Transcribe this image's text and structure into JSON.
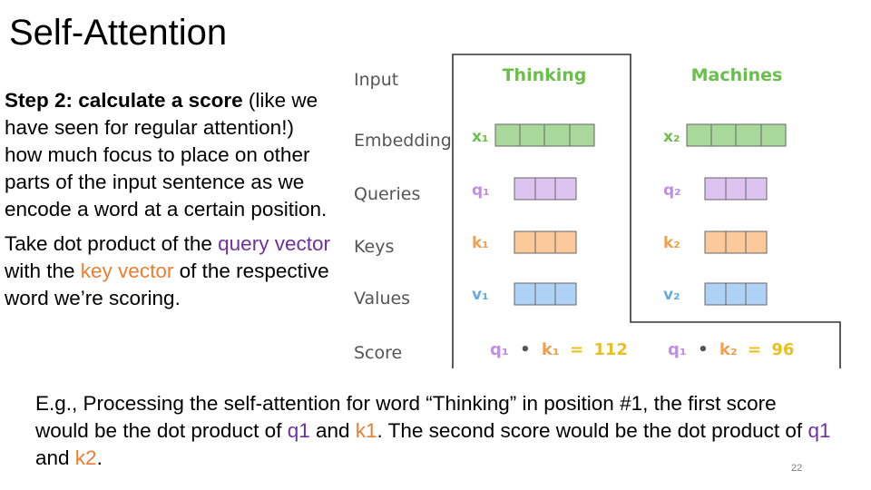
{
  "title": "Self-Attention",
  "left": {
    "p1": {
      "bold": "Step 2: calculate a score",
      "rest": " (like we have seen for regular attention!)  how much focus to place on other parts of the input sentence as we encode a word at a certain position."
    },
    "p2": {
      "a": "Take dot product of the ",
      "query": "query vector",
      "b": " with the ",
      "key": "key vector",
      "c": " of the respective word we’re scoring."
    }
  },
  "bottom": {
    "a": "E.g., Processing the self-attention for word “Thinking” in position #1, the first score would be the dot product of ",
    "q1": "q1",
    "b": " and ",
    "k1": "k1",
    "c": ". The second score would be the dot product of ",
    "q1b": "q1",
    "d": " and ",
    "k2": "k2",
    "e": "."
  },
  "page_number": "22",
  "diagram": {
    "row_labels": {
      "input": "Input",
      "embedding": "Embedding",
      "queries": "Queries",
      "keys": "Keys",
      "values": "Values",
      "score": "Score"
    },
    "columns": [
      {
        "word": "Thinking",
        "x": "x₁",
        "q": "q₁",
        "k": "k₁",
        "v": "v₁",
        "score": {
          "q": "q₁",
          "dot": "•",
          "k": "k₁",
          "eq": "=",
          "value": "112"
        }
      },
      {
        "word": "Machines",
        "x": "x₂",
        "q": "q₂",
        "k": "k₂",
        "v": "v₂",
        "score": {
          "q": "q₁",
          "dot": "•",
          "k": "k₂",
          "eq": "=",
          "value": "96"
        }
      }
    ],
    "colors": {
      "embedding": "#a8d89a",
      "query": "#dcc3f0",
      "key": "#fcc99a",
      "value": "#aed2f5",
      "word": "#6abf4b",
      "x_label": "#6abf4b",
      "q_label": "#c28ee0",
      "k_label": "#f0a050",
      "v_label": "#6aa8e0"
    }
  }
}
